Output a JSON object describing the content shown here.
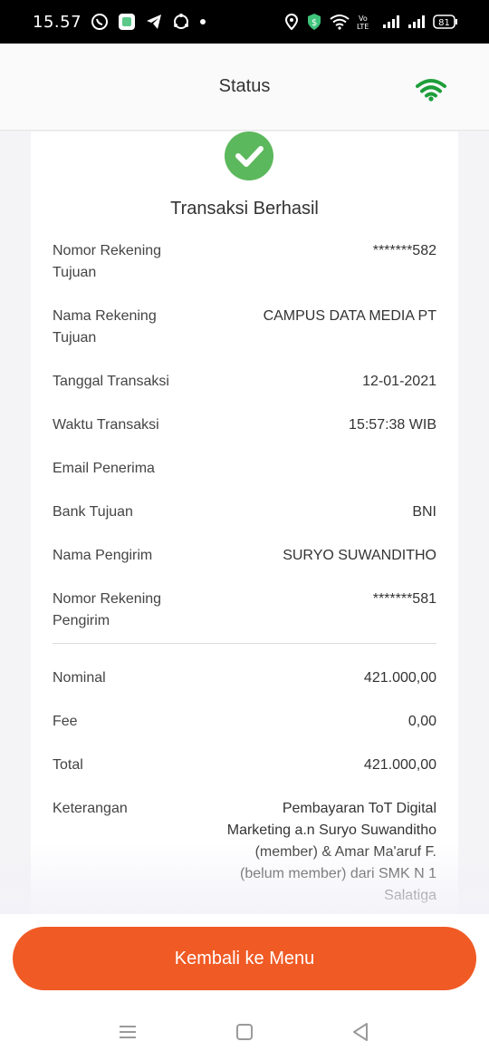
{
  "status_bar": {
    "time": "15.57",
    "battery": "81"
  },
  "header": {
    "title": "Status"
  },
  "receipt": {
    "title": "Transaksi Berhasil",
    "rows": [
      {
        "label": "Nomor Rekening Tujuan",
        "value": "*******582"
      },
      {
        "label": "Nama Rekening Tujuan",
        "value": "CAMPUS DATA MEDIA PT"
      },
      {
        "label": "Tanggal Transaksi",
        "value": "12-01-2021"
      },
      {
        "label": "Waktu Transaksi",
        "value": "15:57:38 WIB"
      },
      {
        "label": "Email Penerima",
        "value": ""
      },
      {
        "label": "Bank Tujuan",
        "value": "BNI"
      },
      {
        "label": "Nama Pengirim",
        "value": "SURYO SUWANDITHO"
      },
      {
        "label": "Nomor Rekening Pengirim",
        "value": "*******581"
      }
    ],
    "summary": [
      {
        "label": "Nominal",
        "value": "421.000,00"
      },
      {
        "label": "Fee",
        "value": "0,00"
      },
      {
        "label": "Total",
        "value": "421.000,00"
      },
      {
        "label": "Keterangan",
        "value": "Pembayaran ToT Digital Marketing a.n Suryo Suwanditho (member) & Amar Ma'aruf F. (belum member) dari SMK N 1 Salatiga"
      }
    ]
  },
  "actions": {
    "back_label": "Kembali ke Menu"
  },
  "colors": {
    "accent": "#f05a24",
    "success": "#5cb85c",
    "wifi": "#1e9e3a"
  }
}
